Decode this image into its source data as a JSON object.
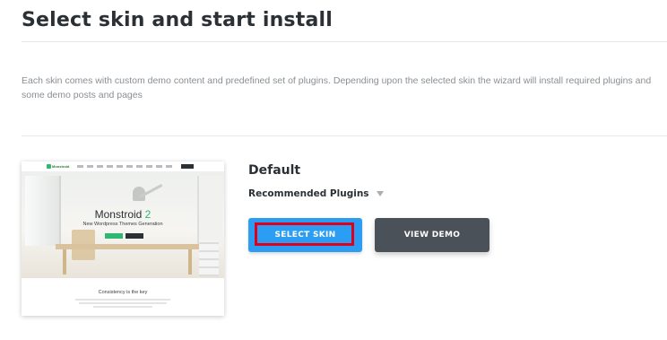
{
  "page": {
    "title": "Select skin and start install",
    "description": "Each skin comes with custom demo content and predefined set of plugins. Depending upon the selected skin the wizard will install required plugins and some demo posts and pages"
  },
  "skin": {
    "name": "Default",
    "plugins_label": "Recommended Plugins",
    "select_label": "SELECT SKIN",
    "demo_label": "VIEW DEMO",
    "preview": {
      "logo": "Monstroid",
      "hero_title": "Monstroid",
      "hero_title_suffix": "2",
      "hero_subtitle": "New Wordpress Themes Generation",
      "footer_title": "Consistency is the key"
    }
  },
  "colors": {
    "select_button": "#2b9df2",
    "demo_button": "#4a5158",
    "highlight_border": "#e0001b",
    "accent_green": "#2eb872"
  }
}
